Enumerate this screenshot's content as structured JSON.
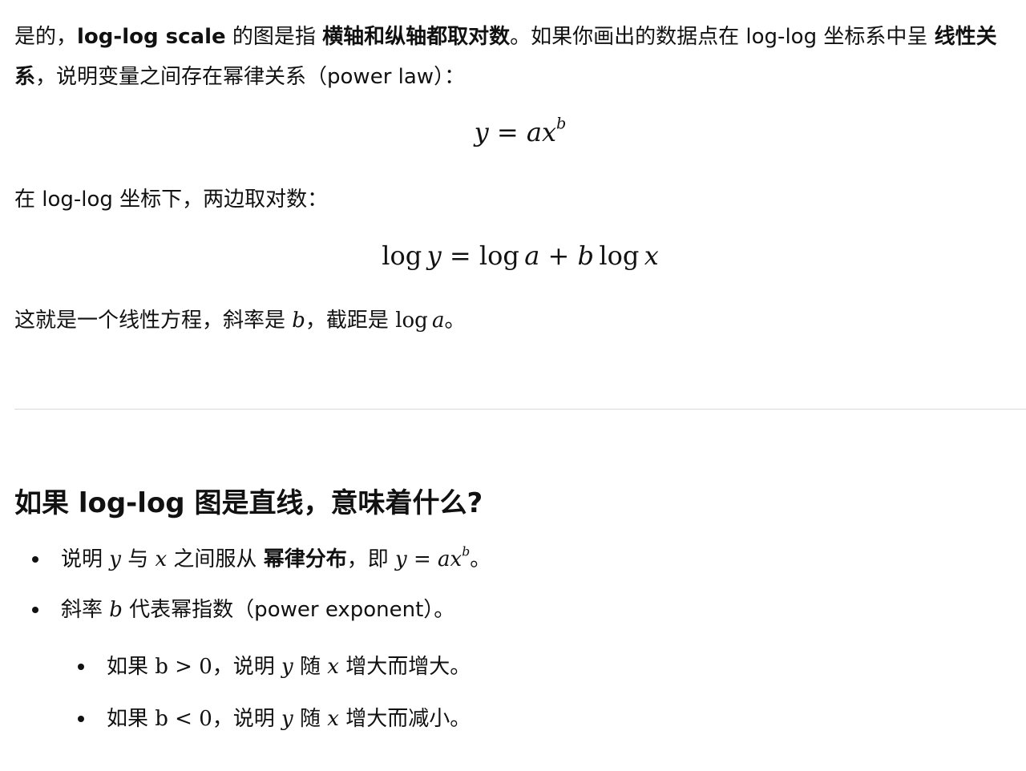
{
  "intro": {
    "p1_a": "是的，",
    "p1_b": "log-log scale",
    "p1_c": " 的图是指 ",
    "p1_d": "横轴和纵轴都取对数",
    "p1_e": "。如果你画出的数据点在 log-log 坐标系中呈 ",
    "p1_f": "线性关系",
    "p1_g": "，说明变量之间存在幂律关系（power law）："
  },
  "formula1": {
    "lhs": "y",
    "eq": " = ",
    "a": "a",
    "x": "x",
    "exp": "b"
  },
  "p2": "在 log-log 坐标下，两边取对数：",
  "formula2": {
    "log1": "log",
    "y": "y",
    "eq": " = ",
    "log2": "log",
    "a": "a",
    "plus": " + ",
    "b": "b",
    "log3": "log",
    "x": "x"
  },
  "p3": {
    "a": "这就是一个线性方程，斜率是 ",
    "b": "b",
    "c": "，截距是 ",
    "log": "log",
    "a_var": "a",
    "d": "。"
  },
  "heading": "如果 log-log 图是直线，意味着什么?",
  "bullets": [
    {
      "t1": "说明 ",
      "y": "y",
      "t2": " 与 ",
      "x": "x",
      "t3": " 之间服从 ",
      "strong": "幂律分布",
      "t4": "，即 ",
      "y2": "y",
      "eq": " = ",
      "a": "a",
      "x2": "x",
      "exp": "b",
      "t5": "。"
    },
    {
      "t1": "斜率 ",
      "b": "b",
      "t2": " 代表幂指数（power exponent）。"
    },
    {
      "t1": "如果 ",
      "cond": "b > 0",
      "t2": "，说明 ",
      "y": "y",
      "t3": " 随 ",
      "x": "x",
      "t4": " 增大而增大。"
    },
    {
      "t1": "如果 ",
      "cond": "b < 0",
      "t2": "，说明 ",
      "y": "y",
      "t3": " 随 ",
      "x": "x",
      "t4": " 增大而减小。"
    }
  ]
}
